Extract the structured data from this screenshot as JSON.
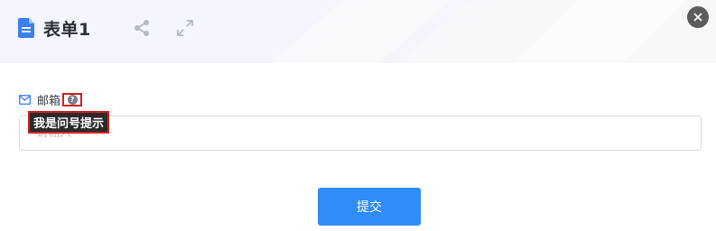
{
  "header": {
    "title": "表单1",
    "icons": [
      "document-icon",
      "share-icon",
      "expand-icon",
      "close-icon"
    ]
  },
  "form": {
    "email_label": "邮箱",
    "help_icon": "question-icon",
    "tooltip": "我是问号提示",
    "email_placeholder": "请输入",
    "email_value": ""
  },
  "actions": {
    "submit_label": "提交"
  },
  "colors": {
    "accent": "#2f8cf8",
    "title_icon": "#3d7ff2",
    "highlight_border": "#d61f1f",
    "tooltip_bg": "#2a2a2a"
  }
}
